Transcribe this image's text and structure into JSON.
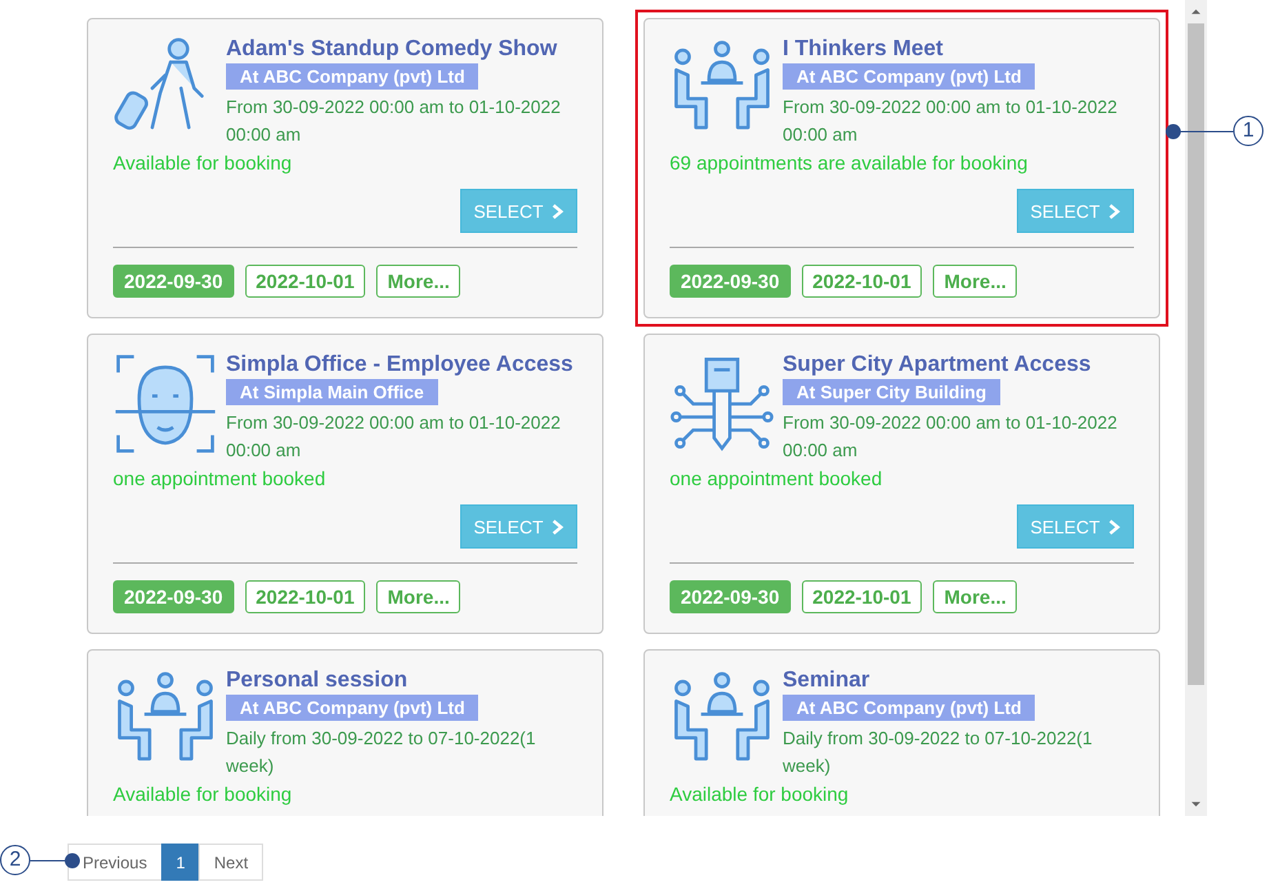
{
  "events": [
    {
      "kind": "traveler",
      "title": "Adam's Standup Comedy Show",
      "location": "At ABC Company (pvt) Ltd",
      "schedule": "From 30-09-2022 00:00 am to 01-10-2022 00:00 am",
      "status": "Available for booking",
      "button_label": "SELECT",
      "highlighted": false,
      "chips": [
        {
          "label": "2022-09-30",
          "selected": true
        },
        {
          "label": "2022-10-01",
          "selected": false
        },
        {
          "label": "More...",
          "selected": false
        }
      ]
    },
    {
      "kind": "meeting",
      "title": "I Thinkers Meet",
      "location": "At ABC Company (pvt) Ltd",
      "schedule": "From 30-09-2022 00:00 am to 01-10-2022 00:00 am",
      "status": "69 appointments are available for booking",
      "button_label": "SELECT",
      "highlighted": true,
      "chips": [
        {
          "label": "2022-09-30",
          "selected": true
        },
        {
          "label": "2022-10-01",
          "selected": false
        },
        {
          "label": "More...",
          "selected": false
        }
      ]
    },
    {
      "kind": "face-scan",
      "title": "Simpla Office - Employee Access",
      "location": "At Simpla Main Office",
      "schedule": "From 30-09-2022 00:00 am to 01-10-2022 00:00 am",
      "status": "one appointment booked",
      "button_label": "SELECT",
      "highlighted": false,
      "chips": [
        {
          "label": "2022-09-30",
          "selected": true
        },
        {
          "label": "2022-10-01",
          "selected": false
        },
        {
          "label": "More...",
          "selected": false
        }
      ]
    },
    {
      "kind": "key",
      "title": "Super City Apartment Access",
      "location": "At Super City Building",
      "schedule": "From 30-09-2022 00:00 am to 01-10-2022 00:00 am",
      "status": "one appointment booked",
      "button_label": "SELECT",
      "highlighted": false,
      "chips": [
        {
          "label": "2022-09-30",
          "selected": true
        },
        {
          "label": "2022-10-01",
          "selected": false
        },
        {
          "label": "More...",
          "selected": false
        }
      ]
    },
    {
      "kind": "meeting",
      "title": "Personal session",
      "location": "At ABC Company (pvt) Ltd",
      "schedule": "Daily from 30-09-2022 to 07-10-2022(1 week)",
      "status": "Available for booking",
      "highlighted": false
    },
    {
      "kind": "meeting",
      "title": "Seminar",
      "location": "At ABC Company (pvt) Ltd",
      "schedule": "Daily from 30-09-2022 to 07-10-2022(1 week)",
      "status": "Available for booking",
      "highlighted": false
    }
  ],
  "pagination": [
    {
      "label": "Previous",
      "selected": false
    },
    {
      "label": "1",
      "selected": true
    },
    {
      "label": "Next",
      "selected": false
    }
  ],
  "callouts": [
    {
      "label": "1"
    },
    {
      "label": "2"
    }
  ]
}
